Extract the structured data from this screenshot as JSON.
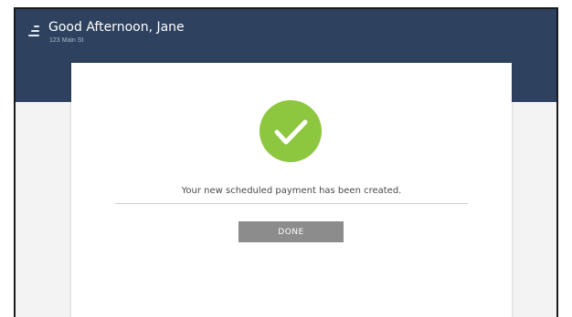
{
  "header": {
    "greeting": "Good Afternoon, Jane",
    "address": "123 Main St",
    "menu_icon": "menu-icon"
  },
  "confirmation": {
    "icon": "checkmark-icon",
    "message": "Your new scheduled payment has been created.",
    "done_label": "DONE"
  },
  "colors": {
    "header_bg": "#2e425f",
    "success_green": "#8dc63f",
    "button_gray": "#8c8c8c"
  }
}
